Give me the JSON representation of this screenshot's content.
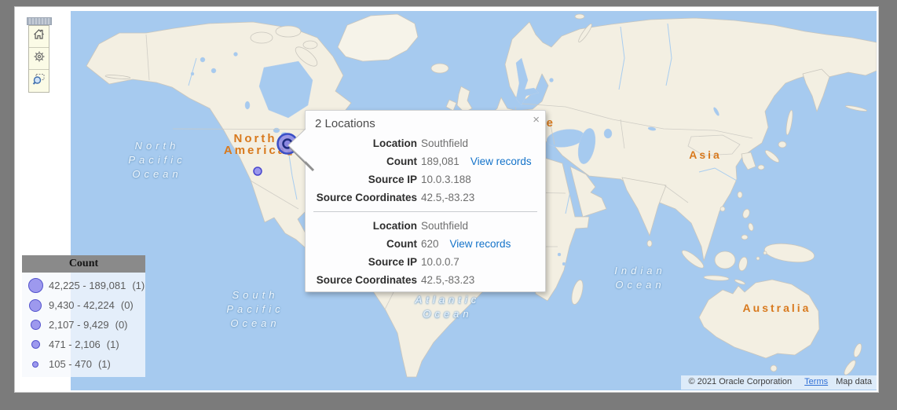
{
  "toolbar": {
    "buttons": [
      {
        "icon": "home"
      },
      {
        "icon": "settings"
      },
      {
        "icon": "zoom-to-area"
      }
    ]
  },
  "map": {
    "ocean_labels": [
      {
        "id": "north-pacific-ocean",
        "lines": [
          "North",
          "Pacific",
          "Ocean"
        ]
      },
      {
        "id": "south-pacific-ocean",
        "lines": [
          "South",
          "Pacific",
          "Ocean"
        ]
      },
      {
        "id": "atlantic-ocean",
        "lines": [
          "Atlantic",
          "Ocean"
        ]
      },
      {
        "id": "indian-ocean",
        "lines": [
          "Indian",
          "Ocean"
        ]
      }
    ],
    "region_labels": [
      {
        "id": "north-america",
        "lines": [
          "North",
          "America"
        ]
      },
      {
        "id": "europe",
        "lines": [
          "Europe"
        ]
      },
      {
        "id": "asia",
        "lines": [
          "Asia"
        ]
      },
      {
        "id": "australia",
        "lines": [
          "Australia"
        ]
      }
    ],
    "colors": {
      "ocean": "#A6CAEF",
      "land": "#F3EFE2",
      "marker_fill": "#938FE6",
      "marker_stroke": "#3D50C4",
      "selected_marker_ring": "#1E2B80",
      "region_label": "#D8791D",
      "link_blue": "#1473C9"
    }
  },
  "popup": {
    "title": "2 Locations",
    "close_label": "×",
    "view_records_label": "View records",
    "field_labels": {
      "location": "Location",
      "count": "Count",
      "source_ip": "Source IP",
      "source_coordinates": "Source Coordinates"
    },
    "records": [
      {
        "location": "Southfield",
        "count": "189,081",
        "source_ip": "10.0.3.188",
        "source_coordinates": "42.5,-83.23"
      },
      {
        "location": "Southfield",
        "count": "620",
        "source_ip": "10.0.0.7",
        "source_coordinates": "42.5,-83.23"
      }
    ]
  },
  "legend": {
    "title": "Count",
    "items": [
      {
        "range": "42,225 - 189,081",
        "count": "(1)"
      },
      {
        "range": "9,430 - 42,224",
        "count": "(0)"
      },
      {
        "range": "2,107 - 9,429",
        "count": "(0)"
      },
      {
        "range": "471 - 2,106",
        "count": "(1)"
      },
      {
        "range": "105 - 470",
        "count": "(1)"
      }
    ]
  },
  "attribution": {
    "copyright": "© 2021 Oracle Corporation",
    "terms_label": "Terms",
    "map_data_label": "Map data"
  }
}
